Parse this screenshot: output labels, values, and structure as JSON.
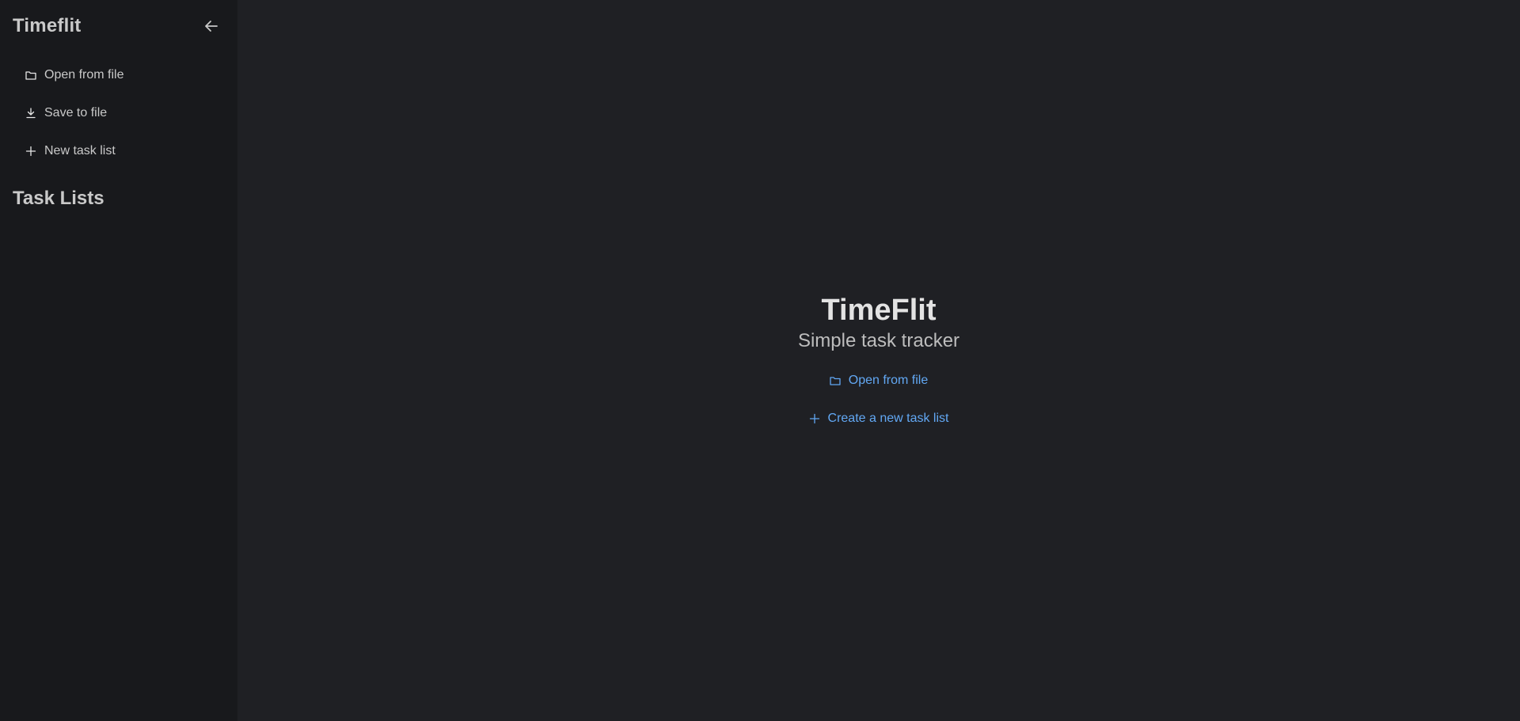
{
  "sidebar": {
    "title": "Timeflit",
    "collapse_icon": "arrow-left-icon",
    "items": [
      {
        "label": "Open from file",
        "icon": "folder-icon"
      },
      {
        "label": "Save to file",
        "icon": "download-icon"
      },
      {
        "label": "New task list",
        "icon": "plus-icon"
      }
    ],
    "section_title": "Task Lists"
  },
  "main": {
    "title": "TimeFlit",
    "subtitle": "Simple task tracker",
    "actions": [
      {
        "label": "Open from file",
        "icon": "folder-icon"
      },
      {
        "label": "Create a new task list",
        "icon": "plus-icon"
      }
    ]
  },
  "colors": {
    "sidebar_bg": "#18191c",
    "main_bg": "#1f2024",
    "text": "#c9c9c9",
    "accent": "#62a8f4"
  }
}
